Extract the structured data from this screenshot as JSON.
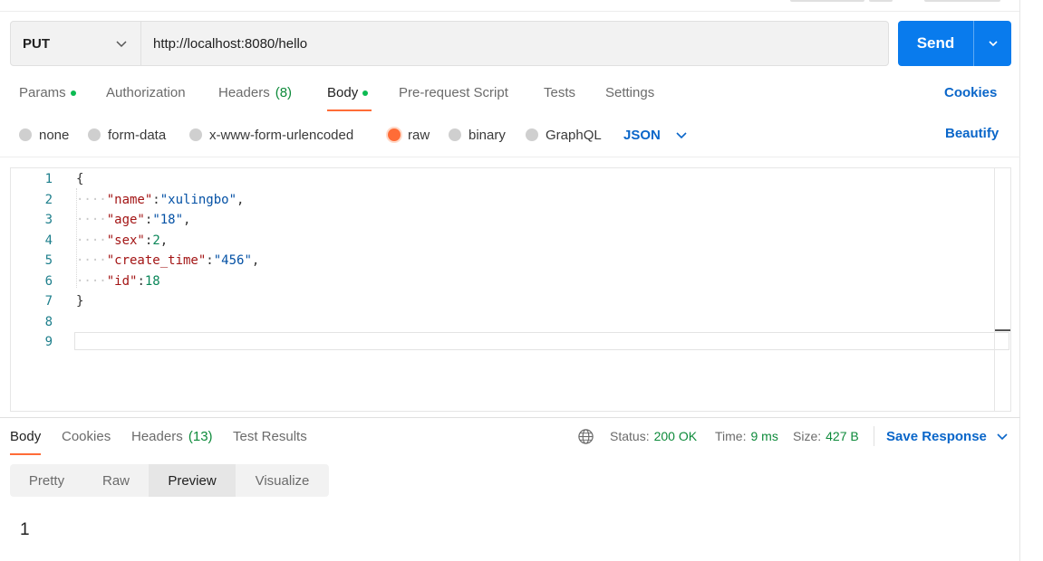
{
  "request": {
    "method": "PUT",
    "url": "http://localhost:8080/hello",
    "send_label": "Send"
  },
  "request_tabs": [
    {
      "label": "Params",
      "dot": true
    },
    {
      "label": "Authorization"
    },
    {
      "label": "Headers",
      "count": "(8)"
    },
    {
      "label": "Body",
      "dot": true,
      "active": true
    },
    {
      "label": "Pre-request Script"
    },
    {
      "label": "Tests"
    },
    {
      "label": "Settings"
    }
  ],
  "cookies_link": "Cookies",
  "body_types": [
    {
      "label": "none"
    },
    {
      "label": "form-data"
    },
    {
      "label": "x-www-form-urlencoded"
    },
    {
      "label": "raw",
      "selected": true
    },
    {
      "label": "binary"
    },
    {
      "label": "GraphQL"
    }
  ],
  "body_language": "JSON",
  "beautify_link": "Beautify",
  "editor": {
    "line_numbers": [
      "1",
      "2",
      "3",
      "4",
      "5",
      "6",
      "7",
      "8",
      "9"
    ],
    "lines": [
      [
        {
          "t": "p",
          "s": "{"
        }
      ],
      [
        {
          "t": "ws",
          "s": "····"
        },
        {
          "t": "key",
          "s": "\"name\""
        },
        {
          "t": "p",
          "s": ":"
        },
        {
          "t": "sv",
          "s": "\"xulingbo\""
        },
        {
          "t": "p",
          "s": ","
        }
      ],
      [
        {
          "t": "ws",
          "s": "····"
        },
        {
          "t": "key",
          "s": "\"age\""
        },
        {
          "t": "p",
          "s": ":"
        },
        {
          "t": "sv",
          "s": "\"18\""
        },
        {
          "t": "p",
          "s": ","
        }
      ],
      [
        {
          "t": "ws",
          "s": "····"
        },
        {
          "t": "key",
          "s": "\"sex\""
        },
        {
          "t": "p",
          "s": ":"
        },
        {
          "t": "nv",
          "s": "2"
        },
        {
          "t": "p",
          "s": ","
        }
      ],
      [
        {
          "t": "ws",
          "s": "····"
        },
        {
          "t": "key",
          "s": "\"create_time\""
        },
        {
          "t": "p",
          "s": ":"
        },
        {
          "t": "sv",
          "s": "\"456\""
        },
        {
          "t": "p",
          "s": ","
        }
      ],
      [
        {
          "t": "ws",
          "s": "····"
        },
        {
          "t": "key",
          "s": "\"id\""
        },
        {
          "t": "p",
          "s": ":"
        },
        {
          "t": "nv",
          "s": "18"
        }
      ],
      [
        {
          "t": "p",
          "s": "}"
        }
      ],
      [],
      []
    ]
  },
  "response_tabs": [
    {
      "label": "Body",
      "active": true
    },
    {
      "label": "Cookies"
    },
    {
      "label": "Headers",
      "count": "(13)"
    },
    {
      "label": "Test Results"
    }
  ],
  "response_meta": {
    "status_label": "Status:",
    "status_value": "200 OK",
    "time_label": "Time:",
    "time_value": "9 ms",
    "size_label": "Size:",
    "size_value": "427 B"
  },
  "save_response": "Save Response",
  "view_modes": [
    {
      "label": "Pretty"
    },
    {
      "label": "Raw"
    },
    {
      "label": "Preview",
      "active": true
    },
    {
      "label": "Visualize"
    }
  ],
  "response_body": "1",
  "colors": {
    "accent": "#ff6c37",
    "send": "#097bed",
    "link": "#0a66c9",
    "success": "#0d8a3a",
    "dot": "#0cbb52"
  }
}
